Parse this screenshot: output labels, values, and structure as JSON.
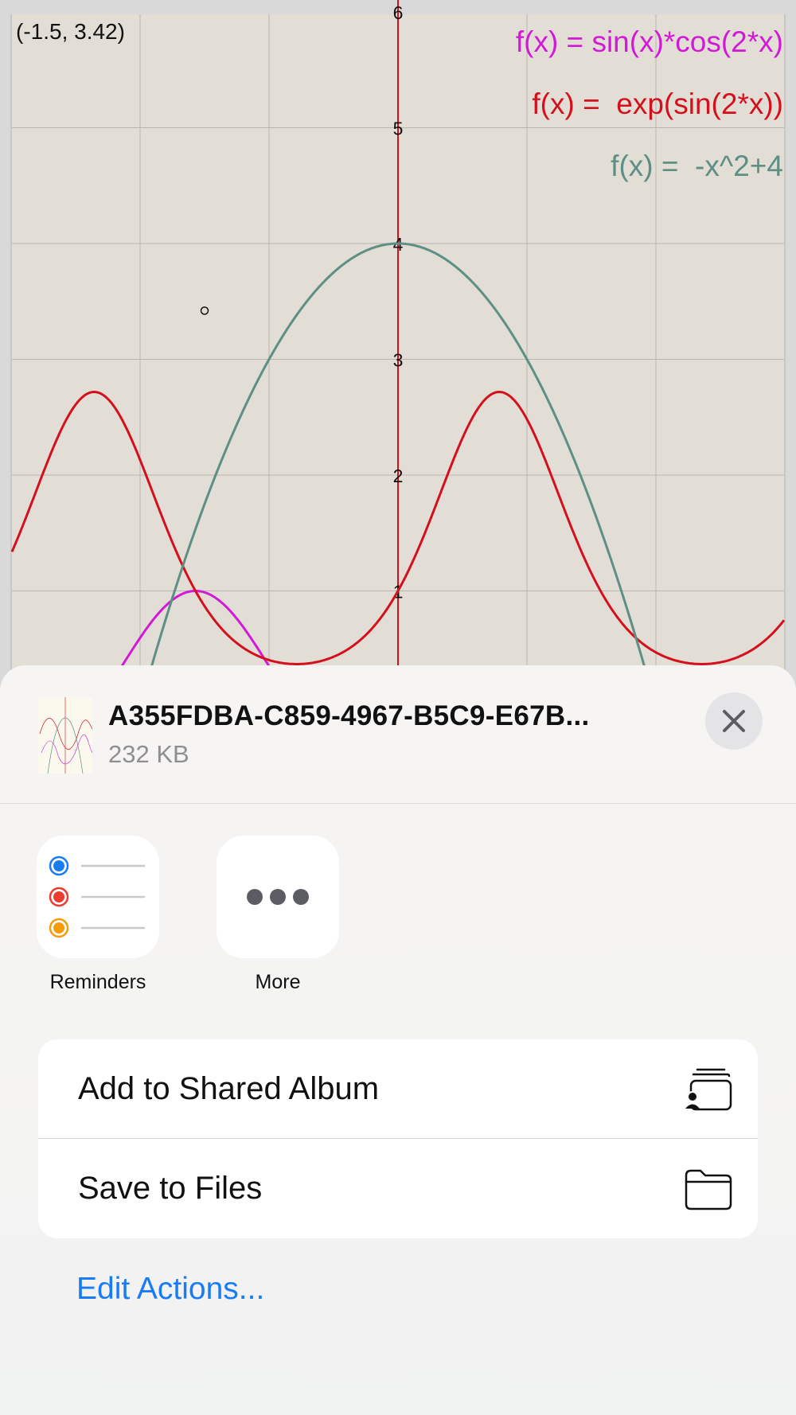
{
  "graph": {
    "coord_readout": "(-1.5, 3.42)",
    "functions": [
      {
        "label": "f(x) = sin(x)*cos(2*x)",
        "color": "#d21ad6"
      },
      {
        "label": "f(x) =  exp(sin(2*x))",
        "color": "#d4101c"
      },
      {
        "label": "f(x) =  -x^2+4",
        "color": "#5e8f84"
      }
    ],
    "y_tick_labels": [
      "1",
      "2",
      "3",
      "4",
      "5",
      "6"
    ],
    "axis_color": "#d4101c",
    "background": "#e2ddd5",
    "traced_point": {
      "x": -1.5,
      "y": 3.42
    }
  },
  "sheet": {
    "file_name": "A355FDBA-C859-4967-B5C9-E67B...",
    "file_size": "232 KB",
    "apps": [
      {
        "label": "Reminders",
        "icon": "reminders-icon"
      },
      {
        "label": "More",
        "icon": "more-icon"
      }
    ],
    "actions": [
      {
        "label": "Add to Shared Album",
        "icon": "shared-album-icon"
      },
      {
        "label": "Save to Files",
        "icon": "folder-icon"
      }
    ],
    "edit_actions": "Edit Actions..."
  }
}
